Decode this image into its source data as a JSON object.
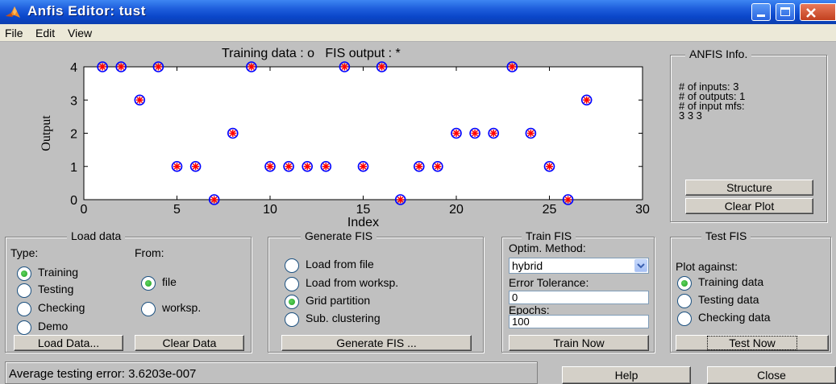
{
  "window": {
    "title": "Anfis Editor: tust"
  },
  "menubar": {
    "items": [
      "File",
      "Edit",
      "View"
    ]
  },
  "plot": {
    "title": "Training data : o   FIS output : *"
  },
  "chart_data": {
    "type": "scatter",
    "title": "Training data : o   FIS output : *",
    "xlabel": "Index",
    "ylabel": "Output",
    "xlim": [
      0,
      30
    ],
    "ylim": [
      0,
      4
    ],
    "xticks": [
      "0",
      "5",
      "10",
      "15",
      "20",
      "25",
      "30"
    ],
    "yticks": [
      "0",
      "1",
      "2",
      "3",
      "4"
    ],
    "x": [
      1,
      2,
      3,
      4,
      5,
      6,
      7,
      8,
      9,
      10,
      11,
      12,
      13,
      14,
      15,
      16,
      17,
      18,
      19,
      20,
      21,
      22,
      23,
      24,
      25,
      26,
      27
    ],
    "series": [
      {
        "name": "Training data",
        "marker": "o",
        "color": "#0000ff",
        "values": [
          4,
          4,
          3,
          4,
          1,
          1,
          0,
          2,
          4,
          1,
          1,
          1,
          1,
          4,
          1,
          4,
          0,
          1,
          1,
          2,
          2,
          2,
          4,
          2,
          1,
          0,
          3
        ]
      },
      {
        "name": "FIS output",
        "marker": "*",
        "color": "#ff0000",
        "values": [
          4,
          4,
          3,
          4,
          1,
          1,
          0,
          2,
          4,
          1,
          1,
          1,
          1,
          4,
          1,
          4,
          0,
          1,
          1,
          2,
          2,
          2,
          4,
          2,
          1,
          0,
          3
        ]
      }
    ]
  },
  "anfis_info": {
    "title": "ANFIS Info.",
    "lines": [
      "# of inputs: 3",
      "# of outputs: 1",
      "# of input mfs:",
      "3  3  3"
    ],
    "structure_label": "Structure",
    "clear_plot_label": "Clear Plot"
  },
  "load_data": {
    "title": "Load data",
    "type_label": "Type:",
    "from_label": "From:",
    "types": [
      "Training",
      "Testing",
      "Checking",
      "Demo"
    ],
    "type_selected": "Training",
    "sources": [
      "file",
      "worksp."
    ],
    "source_selected": "file",
    "load_button": "Load Data...",
    "clear_button": "Clear Data"
  },
  "generate_fis": {
    "title": "Generate FIS",
    "options": [
      "Load from file",
      "Load from worksp.",
      "Grid partition",
      "Sub. clustering"
    ],
    "selected": "Grid partition",
    "button": "Generate FIS ..."
  },
  "train_fis": {
    "title": "Train FIS",
    "optim_label": "Optim. Method:",
    "optim_value": "hybrid",
    "error_tol_label": "Error Tolerance:",
    "error_tol_value": "0",
    "epochs_label": "Epochs:",
    "epochs_value": "100",
    "button": "Train Now"
  },
  "test_fis": {
    "title": "Test FIS",
    "plot_against_label": "Plot against:",
    "options": [
      "Training data",
      "Testing data",
      "Checking data"
    ],
    "selected": "Training data",
    "button": "Test Now"
  },
  "status": {
    "text": "Average testing error: 3.6203e-007"
  },
  "footer": {
    "help_label": "Help",
    "close_label": "Close"
  }
}
